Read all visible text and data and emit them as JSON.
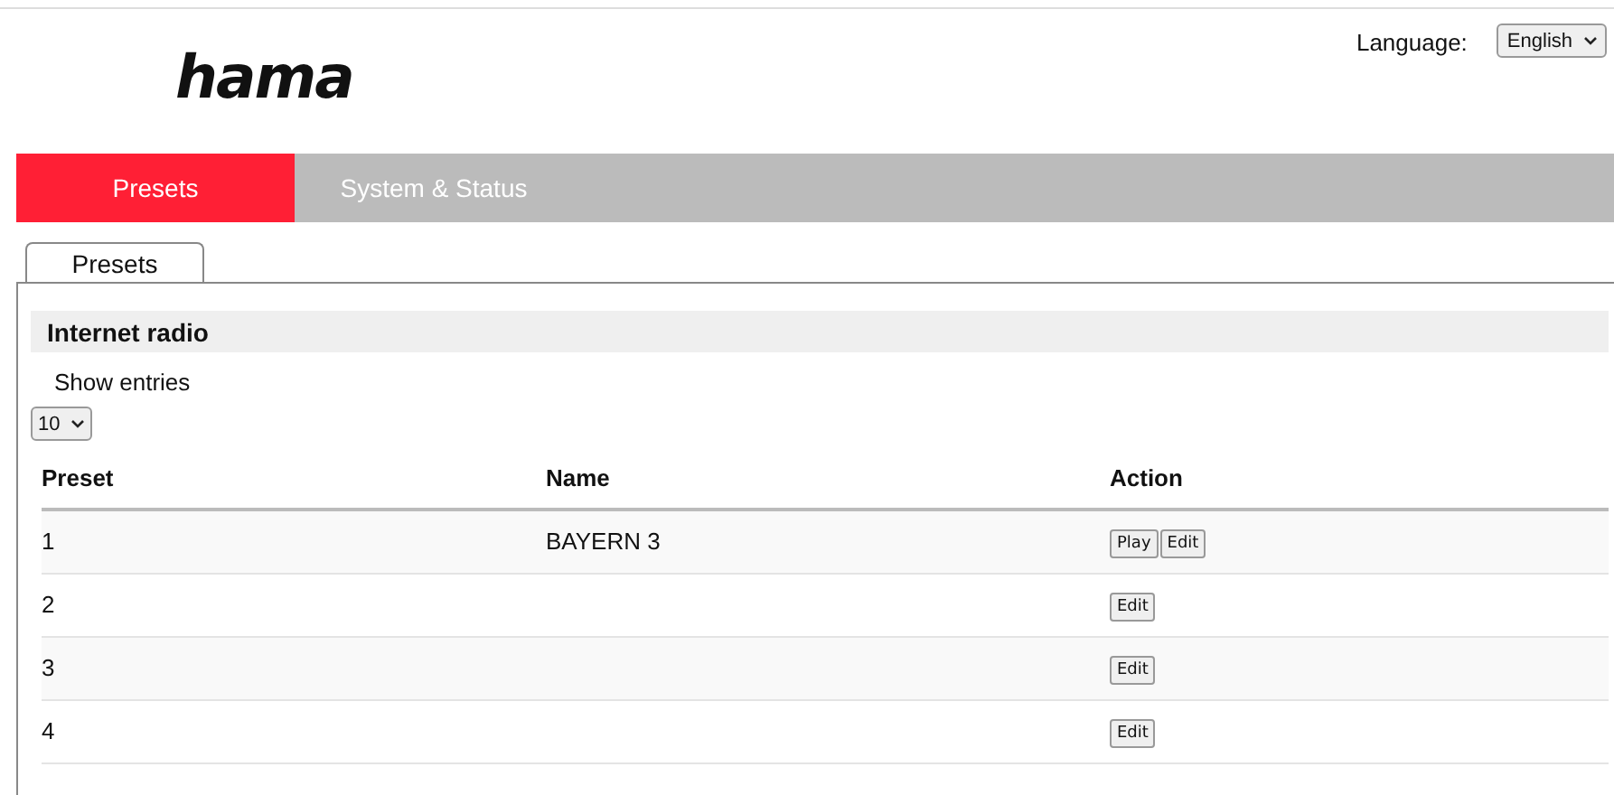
{
  "header": {
    "logo": "hama",
    "language_label": "Language:",
    "language_value": "English"
  },
  "tabs": [
    {
      "label": "Presets",
      "selected": true
    },
    {
      "label": "System & Status",
      "selected": false
    }
  ],
  "subtabs": [
    {
      "label": "Presets",
      "selected": true
    }
  ],
  "section": {
    "title": "Internet radio",
    "show_entries_label": "Show entries",
    "page_size": "10"
  },
  "table": {
    "columns": [
      "Preset",
      "Name",
      "Action"
    ],
    "rows": [
      {
        "preset": "1",
        "name": "BAYERN 3",
        "actions": [
          "Play",
          "Edit"
        ]
      },
      {
        "preset": "2",
        "name": "",
        "actions": [
          "Edit"
        ]
      },
      {
        "preset": "3",
        "name": "",
        "actions": [
          "Edit"
        ]
      },
      {
        "preset": "4",
        "name": "",
        "actions": [
          "Edit"
        ]
      }
    ]
  }
}
